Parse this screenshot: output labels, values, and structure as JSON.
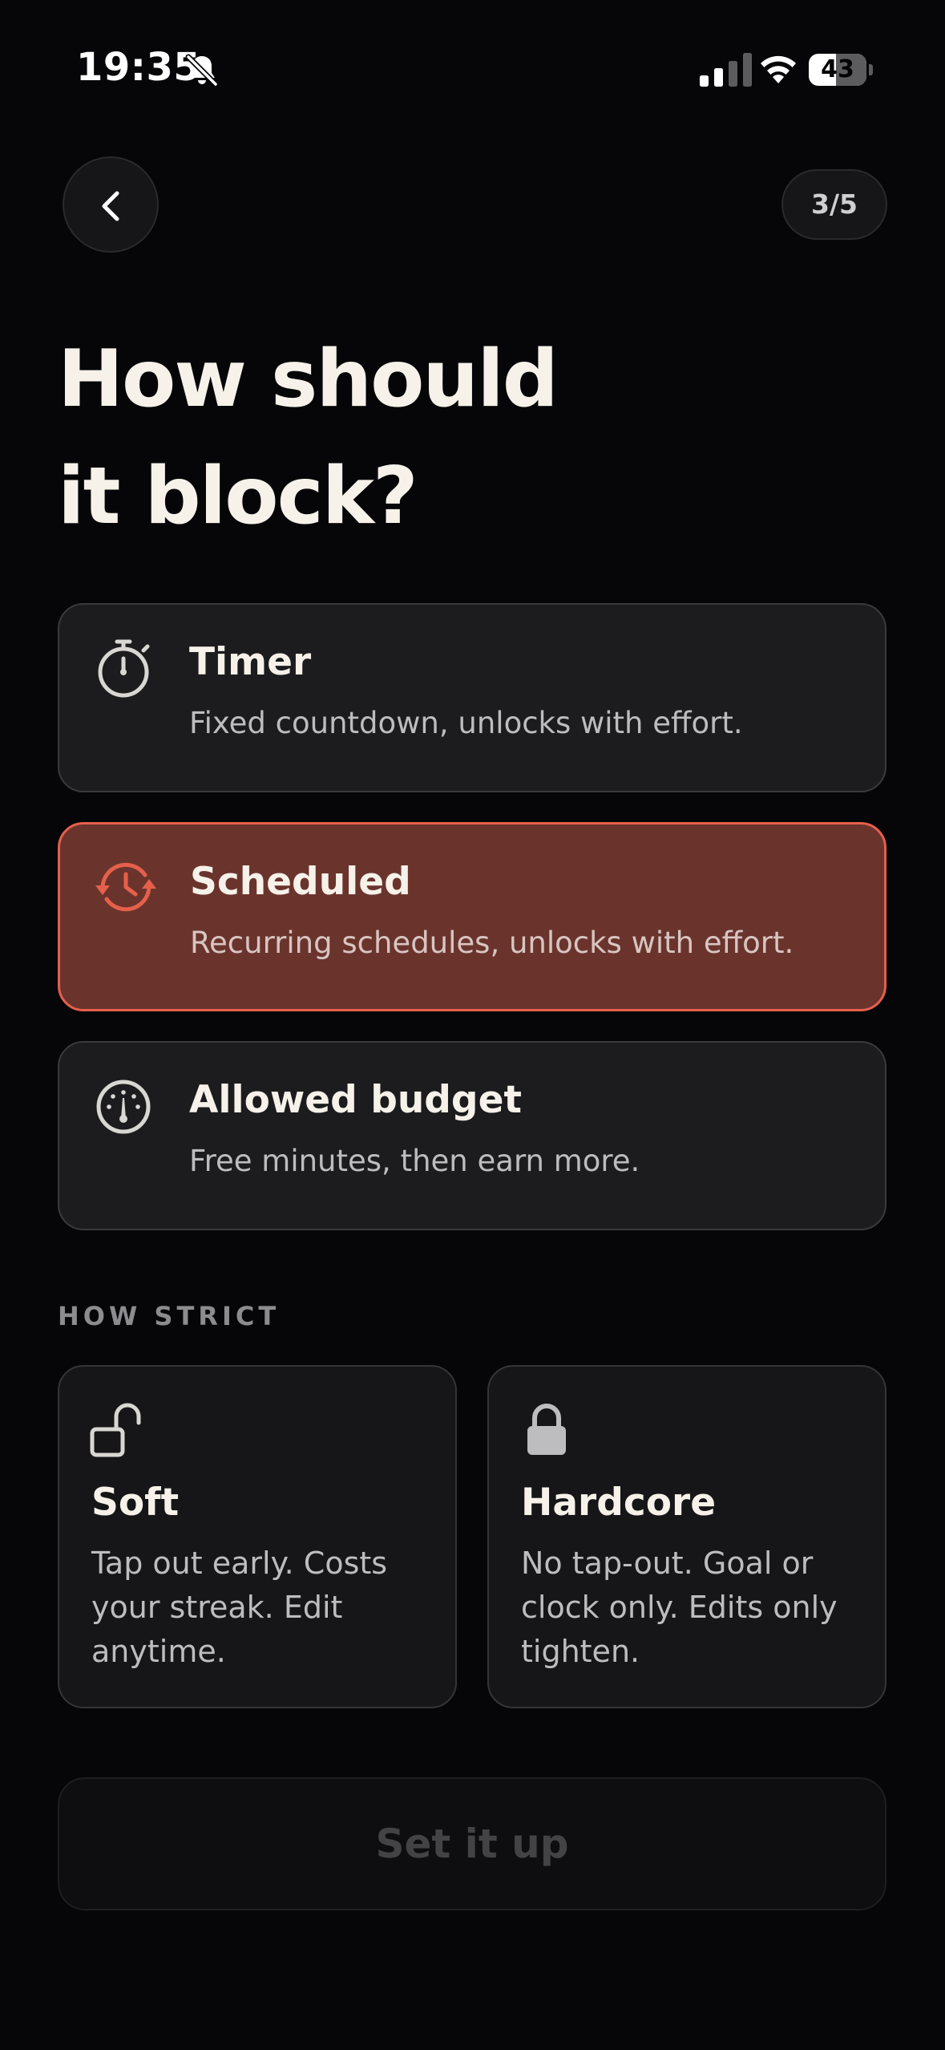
{
  "status_bar": {
    "time": "19:35",
    "battery": "43",
    "icons": [
      "bell-slash-icon",
      "cellular-signal-icon",
      "wifi-icon",
      "battery-icon"
    ]
  },
  "header": {
    "back_icon": "chevron-left-icon",
    "step": "3/5"
  },
  "title": {
    "line1": "How should",
    "line2": "it block?"
  },
  "modes": [
    {
      "title": "Timer",
      "description": "Fixed countdown, unlocks with effort.",
      "icon": "stopwatch-icon",
      "selected": false
    },
    {
      "title": "Scheduled",
      "description": "Recurring schedules, unlocks with effort.",
      "icon": "clock-cycle-icon",
      "selected": true
    },
    {
      "title": "Allowed budget",
      "description": "Free minutes, then earn more.",
      "icon": "gauge-icon",
      "selected": false
    }
  ],
  "strictness": {
    "label": "HOW STRICT",
    "options": [
      {
        "title": "Soft",
        "description": "Tap out early. Costs your streak. Edit anytime.",
        "icon": "unlocked-padlock-icon"
      },
      {
        "title": "Hardcore",
        "description": "No tap-out. Goal or clock only. Edits only tighten.",
        "icon": "locked-padlock-icon"
      }
    ]
  },
  "cta": {
    "label": "Set it up",
    "enabled": false
  },
  "colors": {
    "background": "#060608",
    "card": "#1c1c1e",
    "selected_card": "#6a342d",
    "accent": "#e5604a",
    "title_text": "#f6f2ea",
    "muted_text": "#bdbcbf",
    "disabled_text": "#434346"
  }
}
